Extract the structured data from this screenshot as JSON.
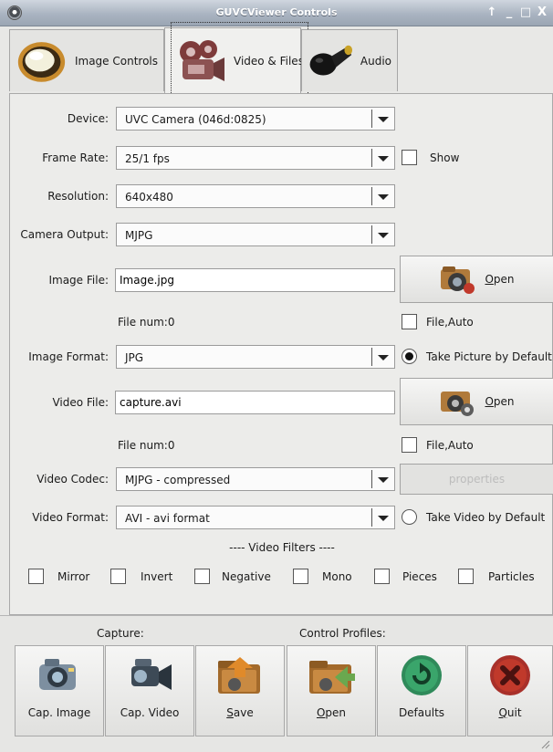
{
  "window": {
    "title": "GUVCViewer Controls",
    "controls": [
      "↑",
      "_",
      "□",
      "X"
    ]
  },
  "tabs": [
    {
      "label": "Image Controls",
      "icon": "monitor-icon"
    },
    {
      "label": "Video & Files",
      "icon": "film-camera-icon"
    },
    {
      "label": "Audio",
      "icon": "microphone-icon"
    }
  ],
  "form": {
    "device": {
      "label": "Device:",
      "value": "UVC Camera (046d:0825)"
    },
    "frame_rate": {
      "label": "Frame Rate:",
      "value": "25/1 fps",
      "show_label": "Show"
    },
    "resolution": {
      "label": "Resolution:",
      "value": "640x480"
    },
    "camera_output": {
      "label": "Camera Output:",
      "value": "MJPG"
    },
    "image_file": {
      "label": "Image File:",
      "value": "Image.jpg",
      "open_label": "Open",
      "open_mnemonic": "O",
      "open_rest": "pen"
    },
    "image_file_num": "File num:0",
    "image_file_auto": "File,Auto",
    "image_format": {
      "label": "Image Format:",
      "value": "JPG",
      "default_label": "Take Picture by Default"
    },
    "video_file": {
      "label": "Video File:",
      "value": "capture.avi",
      "open_mnemonic": "O",
      "open_rest": "pen"
    },
    "video_file_num": "File num:0",
    "video_file_auto": "File,Auto",
    "video_codec": {
      "label": "Video Codec:",
      "value": "MJPG - compressed",
      "properties_label": "properties"
    },
    "video_format": {
      "label": "Video Format:",
      "value": "AVI - avi format",
      "default_label": "Take Video by Default"
    }
  },
  "filters": {
    "title": "---- Video Filters ----",
    "items": [
      "Mirror",
      "Invert",
      "Negative",
      "Mono",
      "Pieces",
      "Particles"
    ]
  },
  "bottom": {
    "capture_label": "Capture:",
    "profiles_label": "Control Profiles:",
    "buttons": [
      {
        "label": "Cap. Image",
        "icon": "camera-icon"
      },
      {
        "label": "Cap. Video",
        "icon": "video-camera-icon"
      },
      {
        "label_mnemonic": "S",
        "label_rest": "ave",
        "icon": "folder-save-icon"
      },
      {
        "label_mnemonic": "O",
        "label_rest": "pen",
        "icon": "folder-open-icon"
      },
      {
        "label": "Defaults",
        "icon": "reset-icon"
      },
      {
        "label_mnemonic": "Q",
        "label_rest": "uit",
        "icon": "quit-icon"
      }
    ]
  },
  "colors": {
    "titlebar": "#aab4c1",
    "panel": "#ececea",
    "defaults_green": "#2f8a5a",
    "quit_red": "#c0392b"
  }
}
